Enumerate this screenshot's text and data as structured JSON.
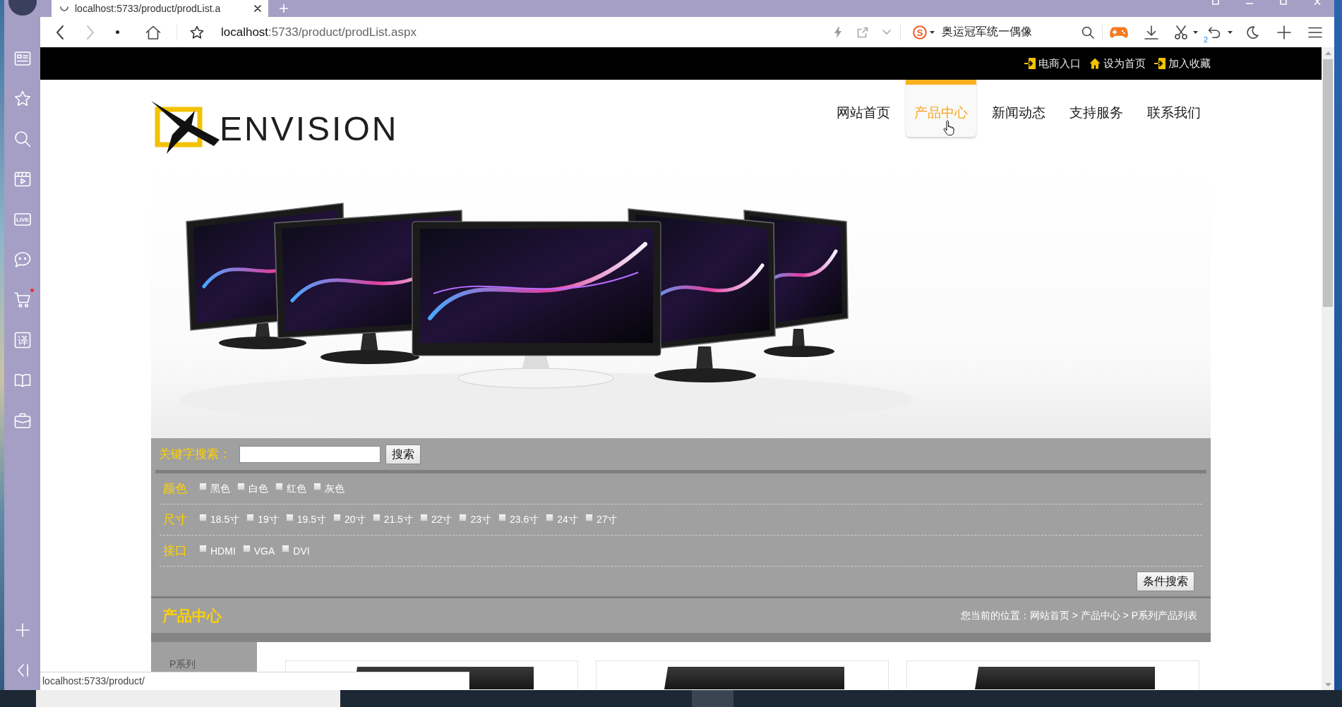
{
  "browser": {
    "tab": {
      "title": "localhost:5733/product/prodList.a"
    },
    "nav_buttons": [
      {
        "kind": "back",
        "disabled": false
      },
      {
        "kind": "forward",
        "disabled": true
      }
    ],
    "address_bar": {
      "host": "localhost",
      "path": ":5733/product/prodList.aspx"
    },
    "search_box": {
      "engine_letter": "S",
      "value": "奥运冠军统一偶像"
    },
    "undo_count": "2",
    "sidebar": [
      {
        "kind": "news",
        "badge": false
      },
      {
        "kind": "favorites",
        "badge": false
      },
      {
        "kind": "search",
        "badge": false
      },
      {
        "kind": "video",
        "badge": false
      },
      {
        "kind": "live",
        "label": "LIVE",
        "badge": false
      },
      {
        "kind": "chat",
        "badge": false
      },
      {
        "kind": "cart",
        "badge": true
      },
      {
        "kind": "translate",
        "label": "译",
        "badge": false
      },
      {
        "kind": "reading",
        "badge": false
      },
      {
        "kind": "toolbox",
        "badge": false
      }
    ],
    "status_bar": {
      "url": "localhost:5733/product/"
    }
  },
  "site": {
    "top_links": [
      {
        "kind": "enter",
        "label": "电商入口"
      },
      {
        "kind": "home",
        "label": "设为首页"
      },
      {
        "kind": "enter",
        "label": "加入收藏"
      }
    ],
    "logo": {
      "text": "ENVISION"
    },
    "nav": [
      {
        "label": "网站首页",
        "selected": false
      },
      {
        "label": "产品中心",
        "selected": true
      },
      {
        "label": "新闻动态",
        "selected": false
      },
      {
        "label": "支持服务",
        "selected": false
      },
      {
        "label": "联系我们",
        "selected": false
      }
    ],
    "keyword_search": {
      "label": "关键字搜索：",
      "button": "搜索"
    },
    "filters": [
      {
        "label": "颜色",
        "options": [
          {
            "label": "黑色",
            "checked": false
          },
          {
            "label": "白色",
            "checked": false
          },
          {
            "label": "红色",
            "checked": false
          },
          {
            "label": "灰色",
            "checked": false
          }
        ]
      },
      {
        "label": "尺寸",
        "options": [
          {
            "label": "18.5寸",
            "checked": false
          },
          {
            "label": "19寸",
            "checked": false
          },
          {
            "label": "19.5寸",
            "checked": false
          },
          {
            "label": "20寸",
            "checked": false
          },
          {
            "label": "21.5寸",
            "checked": false
          },
          {
            "label": "22寸",
            "checked": false
          },
          {
            "label": "23寸",
            "checked": false
          },
          {
            "label": "23.6寸",
            "checked": false
          },
          {
            "label": "24寸",
            "checked": false
          },
          {
            "label": "27寸",
            "checked": false
          }
        ]
      },
      {
        "label": "接口",
        "options": [
          {
            "label": "HDMI",
            "checked": false
          },
          {
            "label": "VGA",
            "checked": false
          },
          {
            "label": "DVI",
            "checked": false
          }
        ]
      }
    ],
    "filter_button": "条件搜索",
    "section_title": "产品中心",
    "breadcrumb": "您当前的位置：网站首页 > 产品中心 > P系列产品列表",
    "categories": [
      {
        "label": "P系列"
      }
    ],
    "products": [
      {
        "kind": "photo"
      },
      {
        "kind": "photo"
      },
      {
        "kind": "photo"
      }
    ]
  }
}
